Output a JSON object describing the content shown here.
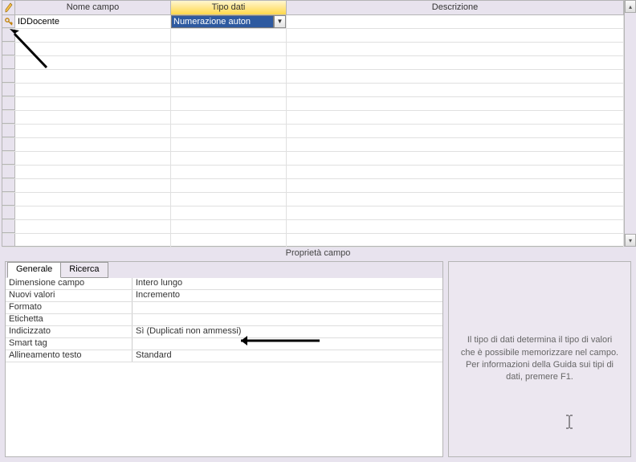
{
  "grid": {
    "headers": {
      "field_name": "Nome campo",
      "data_type": "Tipo dati",
      "description": "Descrizione"
    },
    "row1": {
      "field_name": "IDDocente",
      "data_type": "Numerazione auton"
    }
  },
  "section_label": "Proprietà campo",
  "tabs": {
    "general": "Generale",
    "lookup": "Ricerca"
  },
  "props": [
    {
      "name": "Dimensione campo",
      "value": "Intero lungo"
    },
    {
      "name": "Nuovi valori",
      "value": "Incremento"
    },
    {
      "name": "Formato",
      "value": ""
    },
    {
      "name": "Etichetta",
      "value": ""
    },
    {
      "name": "Indicizzato",
      "value": "Sì (Duplicati non ammessi)"
    },
    {
      "name": "Smart tag",
      "value": ""
    },
    {
      "name": "Allineamento testo",
      "value": "Standard"
    }
  ],
  "help_text": "Il tipo di dati determina il tipo di valori che è possibile memorizzare nel campo. Per informazioni della Guida sui tipi di dati, premere F1."
}
